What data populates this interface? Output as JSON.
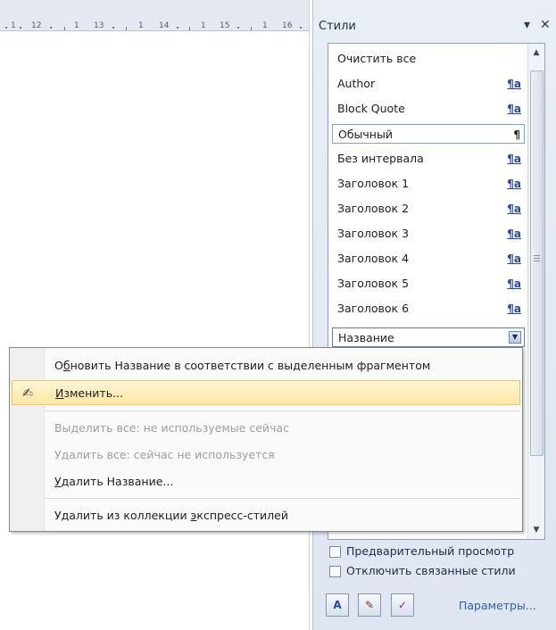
{
  "ruler": {
    "labels": [
      "1",
      "12",
      "1",
      "13",
      "1",
      "14",
      "1",
      "15",
      "1",
      "16"
    ]
  },
  "styles_pane": {
    "title": "Стили",
    "menu_glyph": "▾",
    "close_glyph": "✕",
    "items": [
      {
        "label": "Очистить все",
        "icon": ""
      },
      {
        "label": "Author",
        "icon": "¶a"
      },
      {
        "label": "Block Quote",
        "icon": "¶a"
      },
      {
        "label": "Обычный",
        "icon": "¶"
      },
      {
        "label": "Без интервала",
        "icon": "¶a"
      },
      {
        "label": "Заголовок 1",
        "icon": "¶a"
      },
      {
        "label": "Заголовок 2",
        "icon": "¶a"
      },
      {
        "label": "Заголовок 3",
        "icon": "¶a"
      },
      {
        "label": "Заголовок 4",
        "icon": "¶a"
      },
      {
        "label": "Заголовок 5",
        "icon": "¶a"
      },
      {
        "label": "Заголовок 6",
        "icon": "¶a"
      },
      {
        "label": "Название",
        "icon": ""
      }
    ],
    "options": {
      "preview": "Предварительный просмотр",
      "disable_linked": "Отключить связанные стили"
    },
    "params_link": "Параметры..."
  },
  "context_menu": {
    "update": {
      "pre": "О",
      "key": "б",
      "post": "новить Название в соответствии с выделенным фрагментом"
    },
    "modify": {
      "pre": "",
      "key": "И",
      "post": "зменить..."
    },
    "select_all": "Выделить все: не используемые сейчас",
    "delete_all": "Удалить все: сейчас не используется",
    "delete_style": {
      "pre": "",
      "key": "У",
      "post": "далить Название..."
    },
    "remove_gallery": {
      "pre": "Удалить из коллекции ",
      "key": "э",
      "post": "кспресс-стилей"
    }
  },
  "colors": {
    "accent": "#2747a1",
    "highlight": "#ffe7a2",
    "link": "#2e5fb2"
  }
}
